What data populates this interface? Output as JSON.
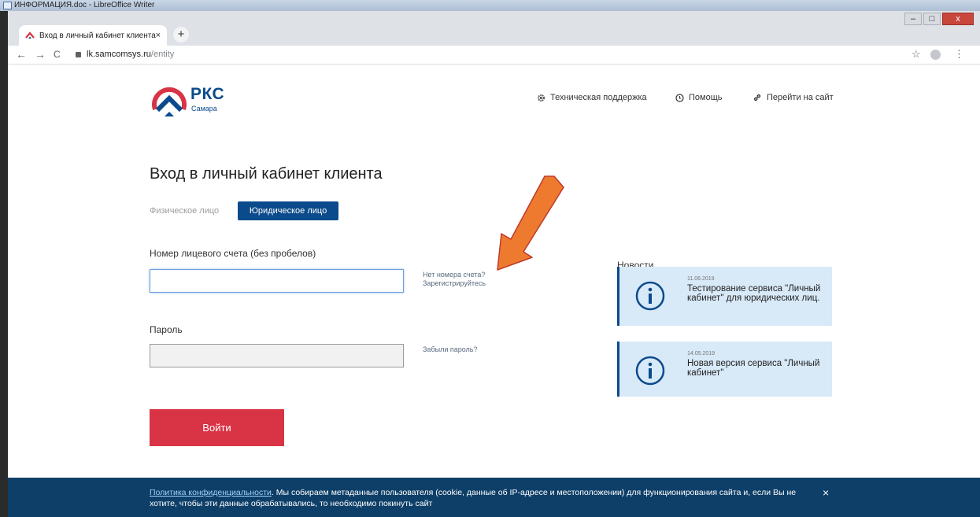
{
  "background_window": {
    "title": "ИНФОРМАЦИЯ.doc - LibreOffice Writer"
  },
  "browser": {
    "tab_title": "Вход в личный кабинет клиента",
    "tab_close": "×",
    "new_tab": "+",
    "url_host": "lk.samcomsys.ru",
    "url_path": "/entity",
    "back": "←",
    "forward": "→",
    "reload": "C",
    "star": "☆",
    "menu": "⋮"
  },
  "header": {
    "logo_name": "РКС",
    "logo_sub": "Самара",
    "nav": {
      "support": "Техническая поддержка",
      "help": "Помощь",
      "site": "Перейти на сайт"
    }
  },
  "login": {
    "title": "Вход в личный кабинет клиента",
    "tabs": {
      "individual": "Физическое лицо",
      "legal": "Юридическое лицо"
    },
    "account_label": "Номер лицевого счета (без пробелов)",
    "account_value": "",
    "no_account_hint": "Нет номера счета?",
    "register_link": "Зарегистрируйтесь",
    "password_label": "Пароль",
    "forgot_link": "Забыли пароль?",
    "submit": "Войти"
  },
  "news": {
    "title": "Новости",
    "items": [
      {
        "date": "11.06.2019",
        "text": "Тестирование сервиса \"Личный кабинет\" для юридических лиц."
      },
      {
        "date": "14.05.2019",
        "text": "Новая версия сервиса \"Личный кабинет\""
      }
    ]
  },
  "cookie": {
    "link": "Политика конфиденциальности",
    "text": ". Мы собираем метаданные пользователя (cookie, данные об IP-адресе и местоположении) для функционирования сайта и, если Вы не хотите, чтобы эти данные обрабатывались, то необходимо покинуть сайт",
    "close": "×"
  },
  "colors": {
    "brand_blue": "#0b4a8b",
    "brand_red": "#d93446",
    "cookie_bg": "#0e3f68",
    "news_bg": "#d8e9f8",
    "annotation_arrow": "#ee7a2f"
  }
}
